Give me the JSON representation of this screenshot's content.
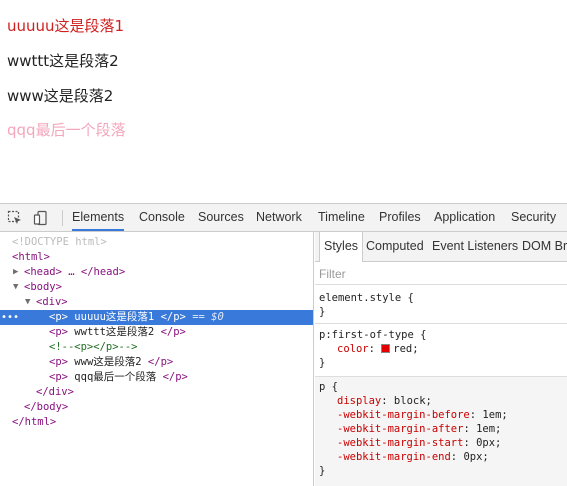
{
  "preview": {
    "lines": [
      "uuuuu这是段落1",
      "wwttt这是段落2",
      "www这是段落2",
      "qqq最后一个段落"
    ]
  },
  "toolbar": {
    "tabs": [
      "Elements",
      "Console",
      "Sources",
      "Network",
      "Timeline",
      "Profiles",
      "Application",
      "Security"
    ],
    "active_tab": "Elements",
    "accent": "#3879d9"
  },
  "dom_tree": {
    "doctype": "<!DOCTYPE html>",
    "html_open": "<html>",
    "head_line": "<head> … </head>",
    "body_open": "<body>",
    "div_open": "<div>",
    "nodes": [
      {
        "open": "<p>",
        "text": "uuuuu这是段落1",
        "close": "</p>",
        "selected": true,
        "marker": "== $0"
      },
      {
        "open": "<p>",
        "text": "wwttt这是段落2",
        "close": "</p>"
      },
      {
        "comment": "<!--<p></p>-->"
      },
      {
        "open": "<p>",
        "text": "www这是段落2",
        "close": "</p>"
      },
      {
        "open": "<p>",
        "text": "qqq最后一个段落",
        "close": "</p>"
      }
    ],
    "div_close": "</div>",
    "body_close": "</body>",
    "html_close": "</html>",
    "gutter": "•••"
  },
  "styles": {
    "subtabs": [
      "Styles",
      "Computed",
      "Event Listeners",
      "DOM Bre"
    ],
    "filter_placeholder": "Filter",
    "element_style": {
      "selector": "element.style {",
      "close": "}"
    },
    "first_of_type": {
      "selector": "p:first-of-type {",
      "prop": "color",
      "value": "red;",
      "swatch_color": "#e00000",
      "close": "}"
    },
    "ua_rule": {
      "selector": "p {",
      "decls": [
        {
          "prop": "display",
          "value": "block;"
        },
        {
          "prop": "-webkit-margin-before",
          "value": "1em;"
        },
        {
          "prop": "-webkit-margin-after",
          "value": "1em;"
        },
        {
          "prop": "-webkit-margin-start",
          "value": "0px;"
        },
        {
          "prop": "-webkit-margin-end",
          "value": "0px;"
        }
      ],
      "close": "}"
    }
  }
}
